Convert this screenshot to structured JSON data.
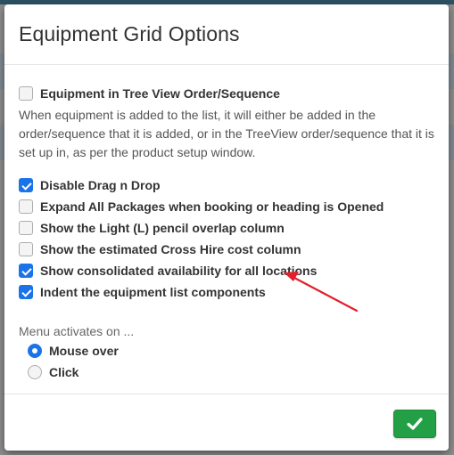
{
  "dialog": {
    "title": "Equipment Grid Options"
  },
  "options": {
    "tree_view_order": {
      "label": "Equipment in Tree View Order/Sequence",
      "checked": false
    },
    "tree_view_help": "When equipment is added to the list, it will either be added in the order/sequence that it is added, or in the TreeView order/sequence that it is set up in, as per the product setup window.",
    "disable_drag_drop": {
      "label": "Disable Drag n Drop",
      "checked": true
    },
    "expand_packages": {
      "label": "Expand All Packages when booking or heading is Opened",
      "checked": false
    },
    "light_pencil_overlap": {
      "label": "Show the Light (L) pencil overlap column",
      "checked": false
    },
    "cross_hire_cost": {
      "label": "Show the estimated Cross Hire cost column",
      "checked": false
    },
    "consolidated_availability": {
      "label": "Show consolidated availability for all locations",
      "checked": true
    },
    "indent_components": {
      "label": "Indent the equipment list components",
      "checked": true
    }
  },
  "menu_activation": {
    "label": "Menu activates on ...",
    "options": [
      {
        "label": "Mouse over",
        "selected": true
      },
      {
        "label": "Click",
        "selected": false
      }
    ]
  },
  "footer": {
    "ok_icon": "check-icon"
  },
  "colors": {
    "accent": "#1a73e8",
    "ok_button": "#23a045",
    "annotation_arrow": "#e0202a"
  }
}
